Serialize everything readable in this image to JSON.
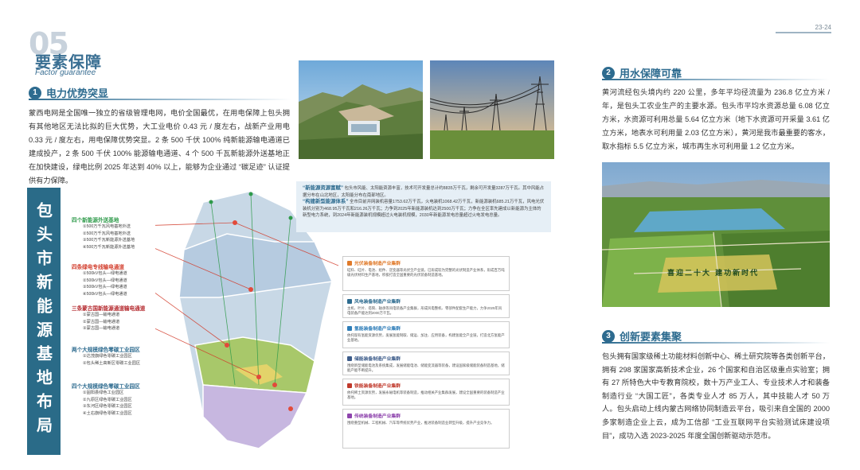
{
  "header": {
    "number": "05",
    "title": "要素保障",
    "subtitle": "Factor guarantee",
    "page_range": "23-24"
  },
  "section1": {
    "index": "1",
    "title": "电力优势突显",
    "text": "蒙西电网是全国唯一独立的省级管理电网，电价全国最优，在用电保障上包头拥有其他地区无法比拟的巨大优势，大工业电价 0.43 元 / 度左右，战新产业用电 0.33 元 / 度左右，用电保障优势突显。2 条 500 千伏 100% 纯新能源输电通道已建成投产，2 条 500 千伏 100% 能源输电通道、4 个 500 千瓦新能源外送基地正在加快建设，绿电比例 2025 年达到 40% 以上，能够为企业通过 “碳足迹” 认证提供有力保障。"
  },
  "banner": {
    "text": "包头市新能源基地布局"
  },
  "map_legend": [
    {
      "title": "四个新能源外送基地",
      "color": "#2e9a4a",
      "items": [
        "①500万千瓦风电基地外送",
        "②500万千瓦风电基地外送",
        "③500万千瓦新能源外送基地",
        "④500万千瓦新能源外送基地"
      ]
    },
    {
      "title": "四条绿电专线输电通道",
      "color": "#d23b2a",
      "items": [
        "①500kV包头—绿电通道",
        "②500kV包头—绿电通道",
        "③500kV包头—绿电通道",
        "④500kV包头—绿电通道"
      ]
    },
    {
      "title": "三条蒙古国新能源通道输电通道",
      "color": "#b3262b",
      "items": [
        "①蒙古国—输电通道",
        "②蒙古国—输电通道",
        "③蒙古国—输电通道"
      ]
    },
    {
      "title": "两个大规模绿色零碳工业园区",
      "color": "#2d6b8f",
      "items": [
        "①达茂旗绿色零碳工业园区",
        "②包头稀土高新区零碳工业园区"
      ]
    },
    {
      "title": "四个大规模绿色零碳工业园区",
      "color": "#2d6b8f",
      "items": [
        "①固阳县绿色工业园区",
        "②九原区绿色零碳工业园区",
        "③东河区绿色零碳工业园区",
        "④土右旗绿色零碳工业园区"
      ]
    }
  ],
  "intro_box": {
    "head1": "“新能源资源富赋”",
    "text1": "包头市风能、太阳能资源丰富，技术可开发量总计约8835万千瓦，剩余可开发量3287万千瓦。其中风能占据分布在山北地区，太阳能分布在南部地区。",
    "head2": "“构建新型能源体系”",
    "text2": "全市目前并网装机容量1753.62万千瓦，火电装机1068.42万千瓦，新能源装机685.21万千瓦，风电光伏装机分别为468.95万千瓦和216.26万千瓦；力争到2025年新能源装机达到2500万千瓦；力争在全区率先建成以新能源为主体的新型电力系统，到2024年新能源装机规模超过火电装机规模，2030年新能源发电总量超过火电发电总量。"
  },
  "clusters": [
    {
      "title": "光伏装备制造产业集群",
      "color": "#e07a2a",
      "text": "硅料、硅片、电池、组件、逆变器等光伏全产业链，已形成较为完整的光伏制造产业体系，形成百万吨级光伏材料生产基地，积极打造全国重要的光伏装备制造基地。"
    },
    {
      "title": "风电装备制造产业集群",
      "color": "#2d6b8f",
      "text": "主机、叶片、塔筒、轴承等风电装备产业集群，形成风电整机、零部件配套生产能力，力争2025年风电装备产能达到2000万千瓦。"
    },
    {
      "title": "氢能装备制造产业集群",
      "color": "#2e7db8",
      "text": "依托现有氢能资源优势，发展氢能制取、储运、加注、应用装备，构建氢能全产业链，打造北方氢能产业基地。"
    },
    {
      "title": "储能装备制造产业集群",
      "color": "#3d5c8a",
      "text": "围绕新型储能电池及系统集成，发展储能电池、储能变流器等装备，建设国家级储能装备制造基地，储能产能不断提升。"
    },
    {
      "title": "铁能装备制造产业集群",
      "color": "#c0392b",
      "text": "依托稀土资源优势，发展永磁电机等装备制造，推动相关产业集群发展，建设全国重要的装备制造产业基地。"
    },
    {
      "title": "传统装备制造产业集群",
      "color": "#8e44ad",
      "text": "围绕重型机械、工程机械、汽车等传统优势产业，推进装备制造业转型升级，提升产业竞争力。"
    }
  ],
  "section2": {
    "index": "2",
    "title": "用水保障可靠",
    "text": "黄河流经包头境内约 220 公里，多年平均径流量为 236.8 亿立方米 / 年，是包头工农业生产的主要水源。包头市平均水资源总量 6.08 亿立方米，水资源可利用总量 5.64 亿立方米（地下水资源可开采量 3.61 亿立方米，地表水可利用量 2.03 亿立方米），黄河是我市最重要的客水，取水指标 5.5 亿立方米，城市再生水可利用量 1.2 亿立方米。"
  },
  "photo_caption": "喜迎二十大 建功新时代",
  "section3": {
    "index": "3",
    "title": "创新要素集聚",
    "text": "包头拥有国家级稀土功能材料创新中心、稀土研究院等各类创新平台，拥有 298 家国家高新技术企业，26 个国家和自治区级重点实验室；拥有 27 所特色大中专教育院校，数十万产业工人、专业技术人才和装备制造行业 “大国工匠”，各类专业人才 85 万人，其中技能人才 50 万人。包头启动上线内蒙古网络协同制造云平台，吸引来自全国的 2000 多家制造企业上云，成为工信部 “工业互联网平台实验测试床建设项目”，成功入选 2023-2025 年度全国创新驱动示范市。"
  }
}
